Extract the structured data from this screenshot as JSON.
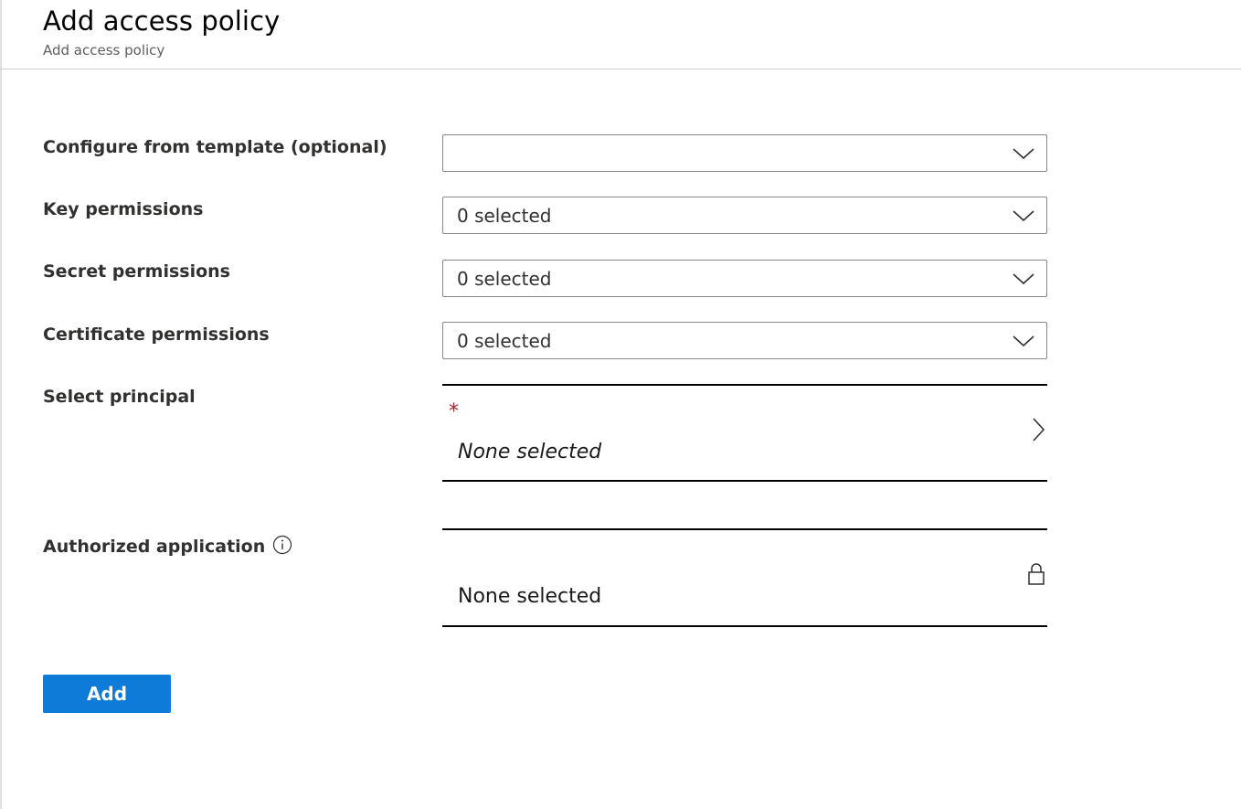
{
  "header": {
    "title": "Add access policy",
    "subtitle": "Add access policy"
  },
  "form": {
    "template": {
      "label": "Configure from template (optional)",
      "value": ""
    },
    "key_permissions": {
      "label": "Key permissions",
      "value": "0 selected"
    },
    "secret_permissions": {
      "label": "Secret permissions",
      "value": "0 selected"
    },
    "certificate_permissions": {
      "label": "Certificate permissions",
      "value": "0 selected"
    },
    "principal": {
      "label": "Select principal",
      "required_marker": "*",
      "value": "None selected"
    },
    "authorized_application": {
      "label": "Authorized application",
      "value": "None selected"
    }
  },
  "actions": {
    "add_label": "Add"
  },
  "colors": {
    "primary_button": "#0f7bd9",
    "required": "#a4262c"
  },
  "icons": {
    "dropdown": "chevron-down-icon",
    "picker": "chevron-right-icon",
    "info": "info-icon",
    "locked": "lock-icon"
  }
}
